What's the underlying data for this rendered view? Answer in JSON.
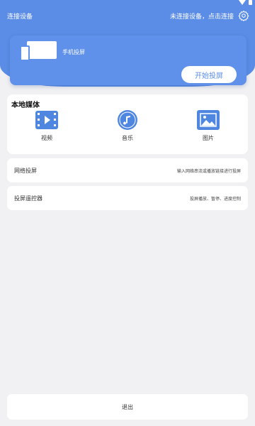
{
  "header": {
    "connect_device_label": "连接设备",
    "status_text": "未连接设备，点击连接",
    "settings_icon": "gear-icon"
  },
  "cast_card": {
    "label": "手机投屏",
    "start_button_label": "开始投屏",
    "icon": "devices-icon"
  },
  "local_media": {
    "title": "本地媒体",
    "items": [
      {
        "label": "视频",
        "icon": "video-icon"
      },
      {
        "label": "音乐",
        "icon": "music-icon"
      },
      {
        "label": "图片",
        "icon": "image-icon"
      }
    ]
  },
  "network_cast": {
    "title": "网络投屏",
    "description": "输入网络串流或播放链接进行投屏"
  },
  "remote_control": {
    "title": "投屏遥控器",
    "description": "投屏播放、暂停、进度控制"
  },
  "exit": {
    "label": "退出"
  },
  "colors": {
    "brand_blue": "#5b8de6",
    "background": "#f1f1f3"
  }
}
